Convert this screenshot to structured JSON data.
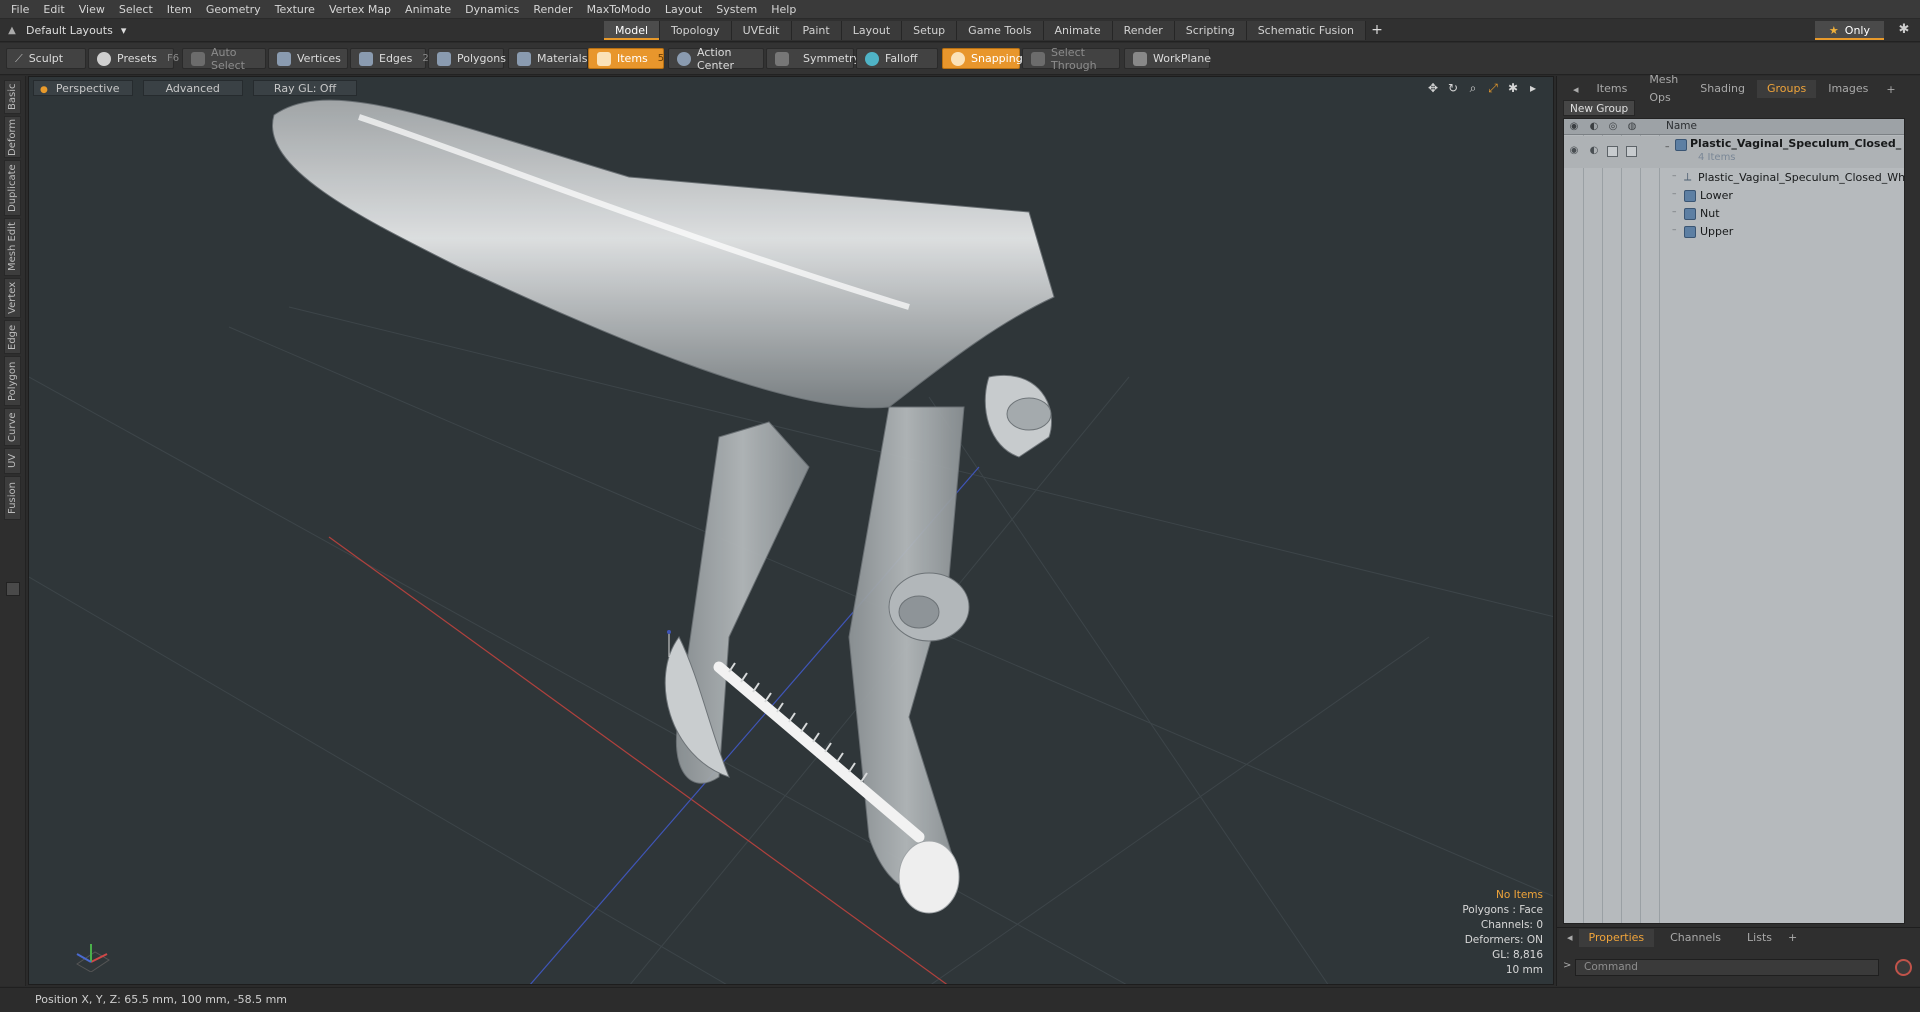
{
  "menu": [
    "File",
    "Edit",
    "View",
    "Select",
    "Item",
    "Geometry",
    "Texture",
    "Vertex Map",
    "Animate",
    "Dynamics",
    "Render",
    "MaxToModo",
    "Layout",
    "System",
    "Help"
  ],
  "layout_selector": "Default Layouts",
  "mode_tabs": [
    "Model",
    "Topology",
    "UVEdit",
    "Paint",
    "Layout",
    "Setup",
    "Game Tools",
    "Animate",
    "Render",
    "Scripting",
    "Schematic Fusion"
  ],
  "active_mode_tab": "Model",
  "only_button": "Only",
  "toolbar": {
    "sculpt": "Sculpt",
    "presets": "Presets",
    "presets_key": "F6",
    "auto_select": "Auto Select",
    "vertices": "Vertices",
    "vertices_count": "1",
    "edges": "Edges",
    "edges_count": "2",
    "polygons": "Polygons",
    "materials": "Materials",
    "items": "Items",
    "items_count": "5",
    "action_center": "Action Center",
    "symmetry": "Symmetry",
    "falloff": "Falloff",
    "snapping": "Snapping",
    "select_through": "Select Through",
    "workplane": "WorkPlane"
  },
  "left_tabs": [
    "Basic",
    "Deform",
    "Duplicate",
    "Mesh Edit",
    "Vertex",
    "Edge",
    "Polygon",
    "Curve",
    "UV",
    "Fusion"
  ],
  "viewport": {
    "view": "Perspective",
    "shading": "Advanced",
    "raygl": "Ray GL: Off",
    "info": {
      "no_items": "No Items",
      "polygons": "Polygons : Face",
      "channels": "Channels: 0",
      "deformers": "Deformers: ON",
      "gl": "GL: 8,816",
      "scale": "10 mm"
    }
  },
  "status": {
    "position": "Position X, Y, Z:  65.5 mm, 100 mm, -58.5 mm"
  },
  "right_panel": {
    "tabs": [
      "Items",
      "Mesh Ops",
      "Shading",
      "Groups",
      "Images"
    ],
    "active_tab": "Groups",
    "new_group": "New Group",
    "name_header": "Name",
    "group_name": "Plastic_Vaginal_Speculum_Closed_ ...",
    "group_count": "4 Items",
    "children": [
      "Plastic_Vaginal_Speculum_Closed_White",
      "Lower",
      "Nut",
      "Upper"
    ],
    "bottom_tabs": [
      "Properties",
      "Channels",
      "Lists"
    ],
    "active_bottom_tab": "Properties",
    "command_placeholder": "Command"
  }
}
